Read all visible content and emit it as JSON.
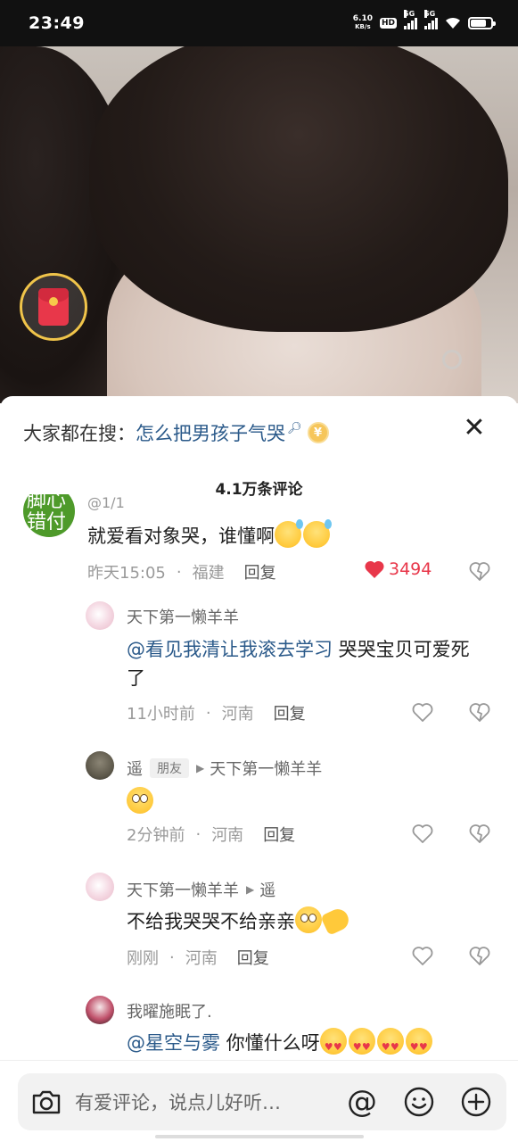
{
  "status_bar": {
    "time": "23:49",
    "net_speed_value": "6.10",
    "net_speed_unit": "KB/s",
    "hd_label": "HD",
    "sim1_label": "5G",
    "sim2_label": "5G",
    "battery_level": 0.75
  },
  "search_suggestion": {
    "prefix": "大家都在搜：",
    "term": "怎么把男孩子气哭",
    "coin_label": "¥"
  },
  "panel": {
    "count_title": "4.1万条评论",
    "close_label": "✕"
  },
  "comments": [
    {
      "avatar_text": "脚心错付",
      "username": "@1/1",
      "text": "就爱看对象哭，谁懂啊",
      "time": "昨天15:05",
      "location": "福建",
      "reply_label": "回复",
      "likes": "3494",
      "liked": true
    },
    {
      "username": "天下第一懒羊羊",
      "mention": "@看见我清让我滚去学习",
      "text": " 哭哭宝贝可爱死了",
      "time": "11小时前",
      "location": "河南",
      "reply_label": "回复"
    },
    {
      "username": "遥",
      "badge": "朋友",
      "reply_to": "天下第一懒羊羊",
      "text": "",
      "time": "2分钟前",
      "location": "河南",
      "reply_label": "回复"
    },
    {
      "username": "天下第一懒羊羊",
      "reply_to": "遥",
      "text": "不给我哭哭不给亲亲",
      "time": "刚刚",
      "location": "河南",
      "reply_label": "回复"
    },
    {
      "username": "我曜施眠了.",
      "mention": "@星空与雾",
      "text": " 你懂什么呀"
    }
  ],
  "input_bar": {
    "placeholder": "有爱评论，说点儿好听…",
    "at_label": "@"
  },
  "colors": {
    "mention": "#2b5a8a",
    "like_red": "#e8374a",
    "muted": "#9a9a9a"
  }
}
